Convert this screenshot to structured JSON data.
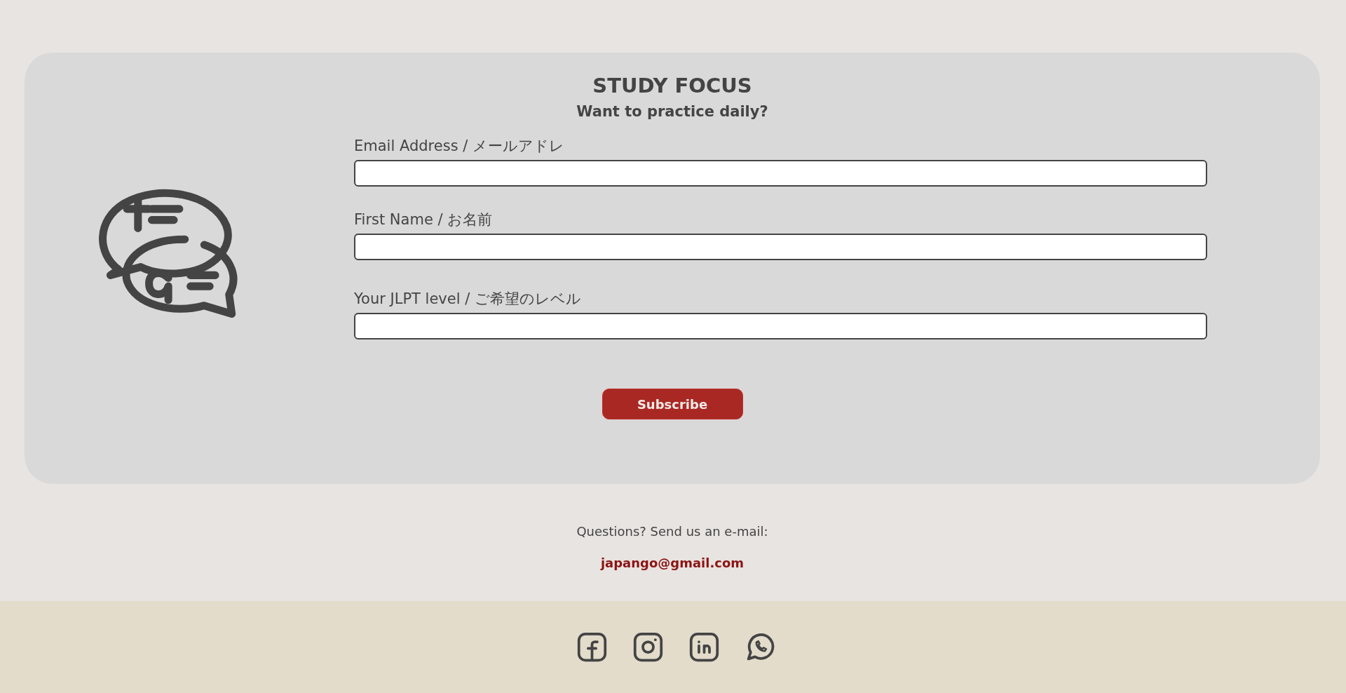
{
  "signup": {
    "title": "STUDY FOCUS",
    "subtitle": "Want to practice daily?",
    "fields": [
      {
        "label": "Email Address / メールアドレ"
      },
      {
        "label": "First Name / お名前"
      },
      {
        "label": "Your JLPT level / ご希望のレベル"
      }
    ],
    "button": "Subscribe"
  },
  "contact": {
    "text": "Questions? Send us an e-mail:",
    "email": "japango@gmail.com"
  },
  "footer": {
    "socials": [
      {
        "kind": "facebook"
      },
      {
        "kind": "instagram"
      },
      {
        "kind": "linkedin"
      },
      {
        "kind": "whatsapp"
      }
    ]
  }
}
